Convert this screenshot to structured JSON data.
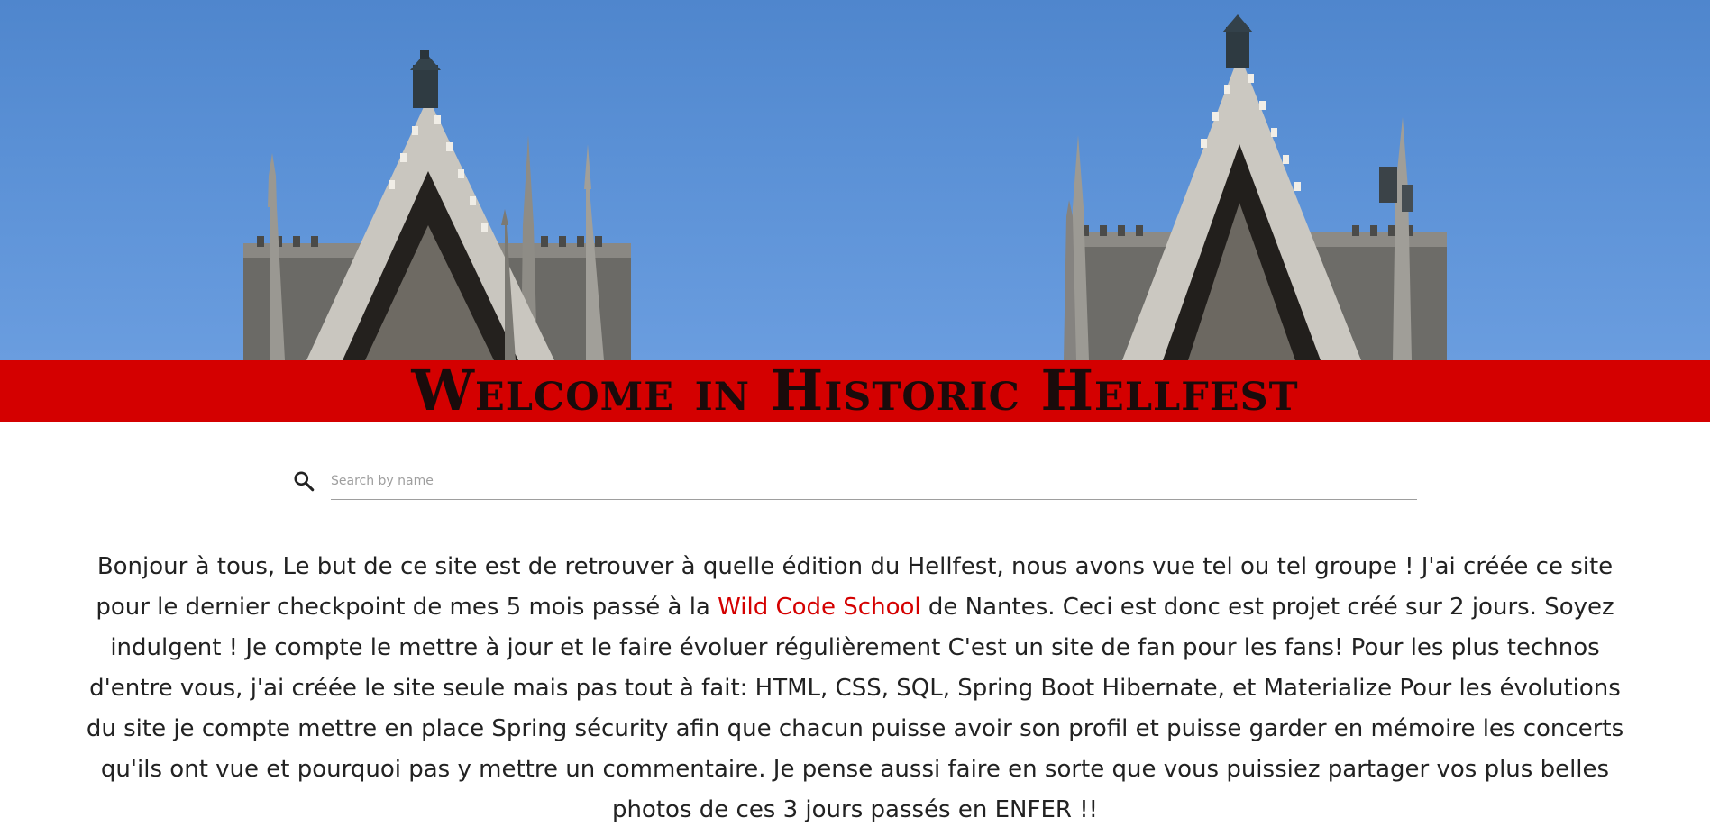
{
  "header": {
    "title": "Welcome in Historic Hellfest",
    "banner_color": "#d40000",
    "hero_image": "cathedral-spires-photo"
  },
  "search": {
    "icon": "search-icon",
    "placeholder": "Search by name",
    "value": ""
  },
  "intro": {
    "part1": "Bonjour à tous, Le but de ce site est de retrouver à quelle édition du Hellfest, nous avons vue tel ou tel groupe ! J'ai créée ce site pour le dernier checkpoint de mes 5 mois passé à la ",
    "link_label": "Wild Code School",
    "part2": " de Nantes. Ceci est donc est projet créé sur 2 jours. Soyez indulgent ! Je compte le mettre à jour et le faire évoluer régulièrement C'est un site de fan pour les fans! Pour les plus technos d'entre vous, j'ai créée le site seule mais pas tout à fait: HTML, CSS, SQL, Spring Boot Hibernate, et Materialize Pour les évolutions du site je compte mettre en place Spring sécurity afin que chacun puisse avoir son profil et puisse garder en mémoire les concerts qu'ils ont vue et pourquoi pas y mettre un commentaire. Je pense aussi faire en sorte que vous puissiez partager vos plus belles photos de ces 3 jours passés en ENFER !!",
    "link_color": "#d40000"
  }
}
